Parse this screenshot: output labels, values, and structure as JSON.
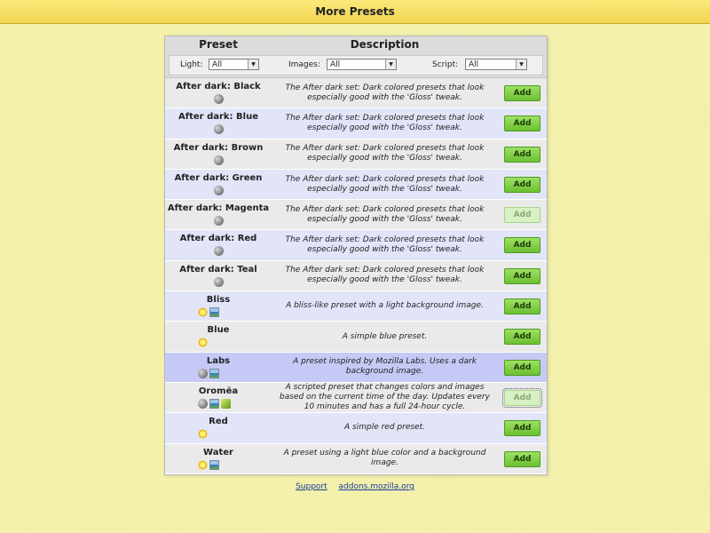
{
  "window": {
    "title": "More Presets"
  },
  "table": {
    "headers": {
      "preset": "Preset",
      "description": "Description"
    },
    "filters": {
      "light": {
        "label": "Light:",
        "value": "All"
      },
      "images": {
        "label": "Images:",
        "value": "All"
      },
      "script": {
        "label": "Script:",
        "value": "All"
      }
    },
    "add_label": "Add",
    "rows": [
      {
        "name": "After dark: Black",
        "icons": [
          "moon-icon"
        ],
        "description": "The After dark set: Dark colored presets that look especially good with the 'Gloss' tweak.",
        "button_state": "enabled"
      },
      {
        "name": "After dark: Blue",
        "icons": [
          "moon-icon"
        ],
        "description": "The After dark set: Dark colored presets that look especially good with the 'Gloss' tweak.",
        "button_state": "enabled"
      },
      {
        "name": "After dark: Brown",
        "icons": [
          "moon-icon"
        ],
        "description": "The After dark set: Dark colored presets that look especially good with the 'Gloss' tweak.",
        "button_state": "enabled"
      },
      {
        "name": "After dark: Green",
        "icons": [
          "moon-icon"
        ],
        "description": "The After dark set: Dark colored presets that look especially good with the 'Gloss' tweak.",
        "button_state": "enabled"
      },
      {
        "name": "After dark: Magenta",
        "icons": [
          "moon-icon"
        ],
        "description": "The After dark set: Dark colored presets that look especially good with the 'Gloss' tweak.",
        "button_state": "disabled"
      },
      {
        "name": "After dark: Red",
        "icons": [
          "moon-icon"
        ],
        "description": "The After dark set: Dark colored presets that look especially good with the 'Gloss' tweak.",
        "button_state": "enabled"
      },
      {
        "name": "After dark: Teal",
        "icons": [
          "moon-icon"
        ],
        "description": "The After dark set: Dark colored presets that look especially good with the 'Gloss' tweak.",
        "button_state": "enabled"
      },
      {
        "name": "Bliss",
        "icons": [
          "sun-icon",
          "image-icon"
        ],
        "description": "A bliss-like preset with a light background image.",
        "button_state": "enabled"
      },
      {
        "name": "Blue",
        "icons": [
          "sun-icon"
        ],
        "description": "A simple blue preset.",
        "button_state": "enabled"
      },
      {
        "name": "Labs",
        "icons": [
          "moon-icon",
          "image-icon"
        ],
        "description": "A preset inspired by Mozilla Labs. Uses a dark background image.",
        "button_state": "enabled",
        "selected": true
      },
      {
        "name": "Oromëa",
        "icons": [
          "moon-icon",
          "image-icon",
          "script-icon"
        ],
        "description": "A scripted preset that changes colors and images based on the current time of the day. Updates every 10 minutes and has a full 24-hour cycle.",
        "button_state": "disabled-focused"
      },
      {
        "name": "Red",
        "icons": [
          "sun-icon"
        ],
        "description": "A simple red preset.",
        "button_state": "enabled"
      },
      {
        "name": "Water",
        "icons": [
          "sun-icon",
          "image-icon"
        ],
        "description": "A preset using a light blue color and a background image.",
        "button_state": "enabled"
      }
    ]
  },
  "footer": {
    "links": [
      "Support",
      "addons.mozilla.org"
    ]
  },
  "colors": {
    "background": "#f3efa6",
    "titlebar": "#f1d452",
    "add_button": "#7dcc3e",
    "row_even": "#eaeaea",
    "row_odd": "#e2e5f8",
    "row_selected": "#c6c9f6"
  }
}
